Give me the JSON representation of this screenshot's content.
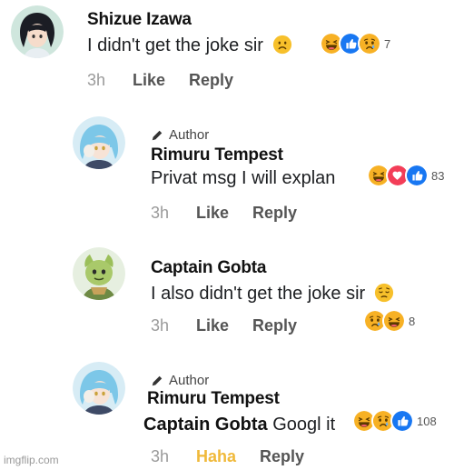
{
  "comments": [
    {
      "name": "Shizue Izawa",
      "text": "I didn't get the joke sir",
      "time": "3h",
      "like": "Like",
      "reply": "Reply",
      "reaction_count": "7"
    },
    {
      "author_label": "Author",
      "name": "Rimuru Tempest",
      "text": "Privat msg I will explan",
      "time": "3h",
      "like": "Like",
      "reply": "Reply",
      "reaction_count": "83"
    },
    {
      "name": "Captain Gobta",
      "text": "I also didn't get the joke sir",
      "time": "3h",
      "like": "Like",
      "reply": "Reply",
      "reaction_count": "8"
    },
    {
      "author_label": "Author",
      "name": "Rimuru Tempest",
      "mention": "Captain Gobta",
      "text": "Googl it",
      "time": "3h",
      "like": "Haha",
      "reply": "Reply",
      "reaction_count": "108"
    }
  ],
  "watermark": "imgflip.com",
  "colors": {
    "like_blue": "#1877f2",
    "love_red": "#f33e58",
    "haha_yellow": "#f7b125",
    "haha_active_text": "#f0b93a"
  }
}
